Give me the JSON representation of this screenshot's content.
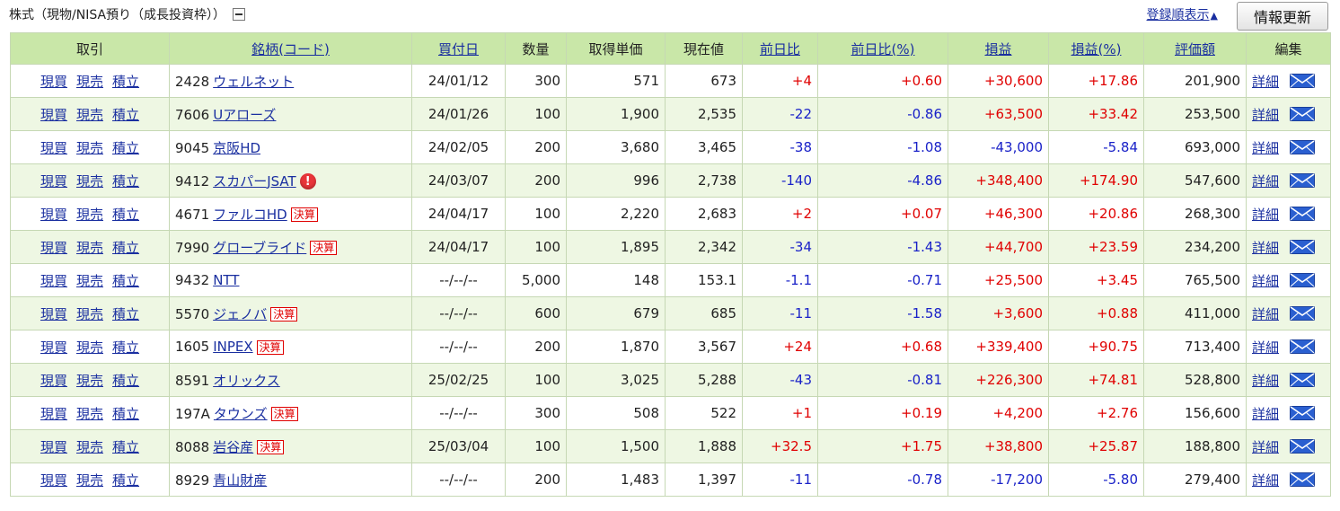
{
  "header": {
    "title": "株式（現物/NISA預り（成長投資枠））",
    "sort_label": "登録順表示",
    "sort_arrow": "▲",
    "refresh_label": "情報更新"
  },
  "columns": [
    {
      "key": "actions",
      "label": "取引",
      "link": false
    },
    {
      "key": "name",
      "label": "銘柄(コード)",
      "link": true
    },
    {
      "key": "date",
      "label": "買付日",
      "link": true
    },
    {
      "key": "qty",
      "label": "数量",
      "link": false
    },
    {
      "key": "cost",
      "label": "取得単価",
      "link": false
    },
    {
      "key": "price",
      "label": "現在値",
      "link": false
    },
    {
      "key": "chg",
      "label": "前日比",
      "link": true
    },
    {
      "key": "chg_pct",
      "label": "前日比(%)",
      "link": true
    },
    {
      "key": "pl",
      "label": "損益",
      "link": true
    },
    {
      "key": "pl_pct",
      "label": "損益(%)",
      "link": true
    },
    {
      "key": "value",
      "label": "評価額",
      "link": true
    },
    {
      "key": "edit",
      "label": "編集",
      "link": false
    }
  ],
  "row_actions": {
    "buy": "現買",
    "sell": "現売",
    "accumulate": "積立",
    "detail": "詳細"
  },
  "badges": {
    "kessan": "決算",
    "alert": "!"
  },
  "colors": {
    "positive": "#e00000",
    "negative": "#1a22c8",
    "header_bg": "#c9e7a8",
    "link": "#1a2fa0"
  },
  "rows": [
    {
      "code": "2428",
      "name": "ウェルネット",
      "badge": "",
      "date": "24/01/12",
      "qty": "300",
      "cost": "571",
      "price": "673",
      "chg": "+4",
      "chg_pct": "+0.60",
      "pl": "+30,600",
      "pl_pct": "+17.86",
      "value": "201,900"
    },
    {
      "code": "7606",
      "name": "Uアローズ",
      "badge": "",
      "date": "24/01/26",
      "qty": "100",
      "cost": "1,900",
      "price": "2,535",
      "chg": "-22",
      "chg_pct": "-0.86",
      "pl": "+63,500",
      "pl_pct": "+33.42",
      "value": "253,500"
    },
    {
      "code": "9045",
      "name": "京阪HD",
      "badge": "",
      "date": "24/02/05",
      "qty": "200",
      "cost": "3,680",
      "price": "3,465",
      "chg": "-38",
      "chg_pct": "-1.08",
      "pl": "-43,000",
      "pl_pct": "-5.84",
      "value": "693,000"
    },
    {
      "code": "9412",
      "name": "スカパーJSAT",
      "badge": "alert",
      "date": "24/03/07",
      "qty": "200",
      "cost": "996",
      "price": "2,738",
      "chg": "-140",
      "chg_pct": "-4.86",
      "pl": "+348,400",
      "pl_pct": "+174.90",
      "value": "547,600"
    },
    {
      "code": "4671",
      "name": "ファルコHD",
      "badge": "kessan",
      "date": "24/04/17",
      "qty": "100",
      "cost": "2,220",
      "price": "2,683",
      "chg": "+2",
      "chg_pct": "+0.07",
      "pl": "+46,300",
      "pl_pct": "+20.86",
      "value": "268,300"
    },
    {
      "code": "7990",
      "name": "グローブライド",
      "badge": "kessan",
      "date": "24/04/17",
      "qty": "100",
      "cost": "1,895",
      "price": "2,342",
      "chg": "-34",
      "chg_pct": "-1.43",
      "pl": "+44,700",
      "pl_pct": "+23.59",
      "value": "234,200"
    },
    {
      "code": "9432",
      "name": "NTT",
      "badge": "",
      "date": "--/--/--",
      "qty": "5,000",
      "cost": "148",
      "price": "153.1",
      "chg": "-1.1",
      "chg_pct": "-0.71",
      "pl": "+25,500",
      "pl_pct": "+3.45",
      "value": "765,500"
    },
    {
      "code": "5570",
      "name": "ジェノバ",
      "badge": "kessan",
      "date": "--/--/--",
      "qty": "600",
      "cost": "679",
      "price": "685",
      "chg": "-11",
      "chg_pct": "-1.58",
      "pl": "+3,600",
      "pl_pct": "+0.88",
      "value": "411,000"
    },
    {
      "code": "1605",
      "name": "INPEX",
      "badge": "kessan",
      "date": "--/--/--",
      "qty": "200",
      "cost": "1,870",
      "price": "3,567",
      "chg": "+24",
      "chg_pct": "+0.68",
      "pl": "+339,400",
      "pl_pct": "+90.75",
      "value": "713,400"
    },
    {
      "code": "8591",
      "name": "オリックス",
      "badge": "",
      "date": "25/02/25",
      "qty": "100",
      "cost": "3,025",
      "price": "5,288",
      "chg": "-43",
      "chg_pct": "-0.81",
      "pl": "+226,300",
      "pl_pct": "+74.81",
      "value": "528,800"
    },
    {
      "code": "197A",
      "name": "タウンズ",
      "badge": "kessan",
      "date": "--/--/--",
      "qty": "300",
      "cost": "508",
      "price": "522",
      "chg": "+1",
      "chg_pct": "+0.19",
      "pl": "+4,200",
      "pl_pct": "+2.76",
      "value": "156,600"
    },
    {
      "code": "8088",
      "name": "岩谷産",
      "badge": "kessan",
      "date": "25/03/04",
      "qty": "100",
      "cost": "1,500",
      "price": "1,888",
      "chg": "+32.5",
      "chg_pct": "+1.75",
      "pl": "+38,800",
      "pl_pct": "+25.87",
      "value": "188,800"
    },
    {
      "code": "8929",
      "name": "青山財産",
      "badge": "",
      "date": "--/--/--",
      "qty": "200",
      "cost": "1,483",
      "price": "1,397",
      "chg": "-11",
      "chg_pct": "-0.78",
      "pl": "-17,200",
      "pl_pct": "-5.80",
      "value": "279,400"
    }
  ]
}
